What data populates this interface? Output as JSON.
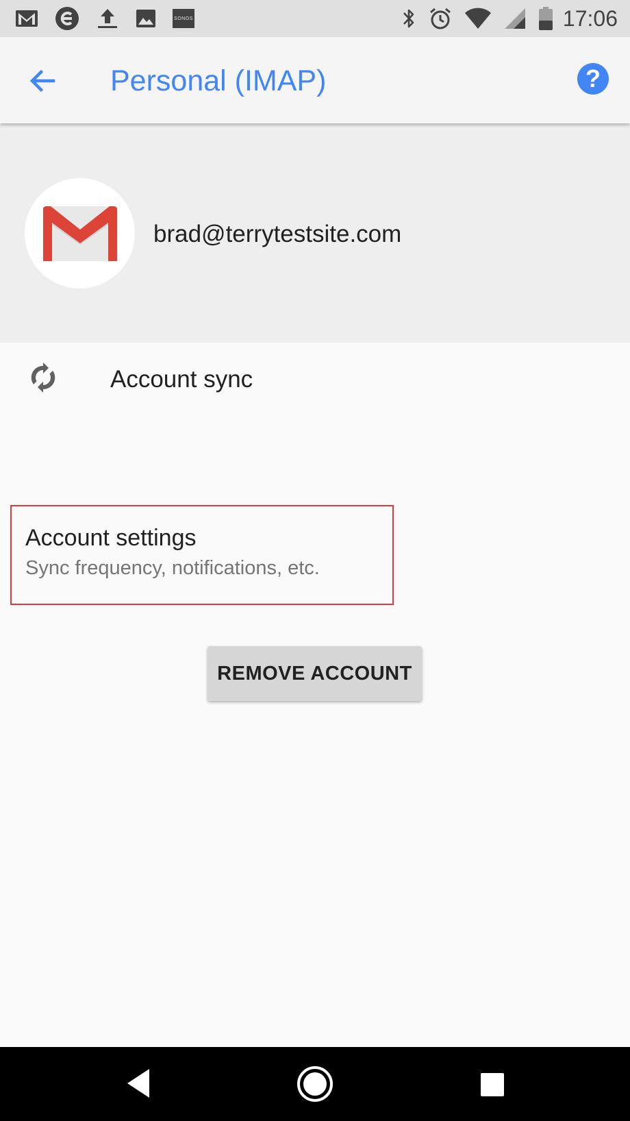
{
  "status_bar": {
    "time": "17:06",
    "left_icons": [
      "gmail-icon",
      "e-icon",
      "upload-icon",
      "image-icon",
      "sonos-icon"
    ],
    "sonos_label": "SONOS",
    "right_icons": [
      "bluetooth-icon",
      "alarm-icon",
      "wifi-icon",
      "signal-icon",
      "battery-icon"
    ]
  },
  "app_bar": {
    "title": "Personal (IMAP)",
    "help_label": "?"
  },
  "account": {
    "email": "brad@terrytestsite.com"
  },
  "sync": {
    "label": "Account sync"
  },
  "settings": {
    "title": "Account settings",
    "subtitle": "Sync frequency, notifications, etc."
  },
  "actions": {
    "remove_label": "REMOVE ACCOUNT"
  },
  "colors": {
    "accent": "#4285f4",
    "highlight_border": "#e53935",
    "gmail_red": "#db4437"
  }
}
